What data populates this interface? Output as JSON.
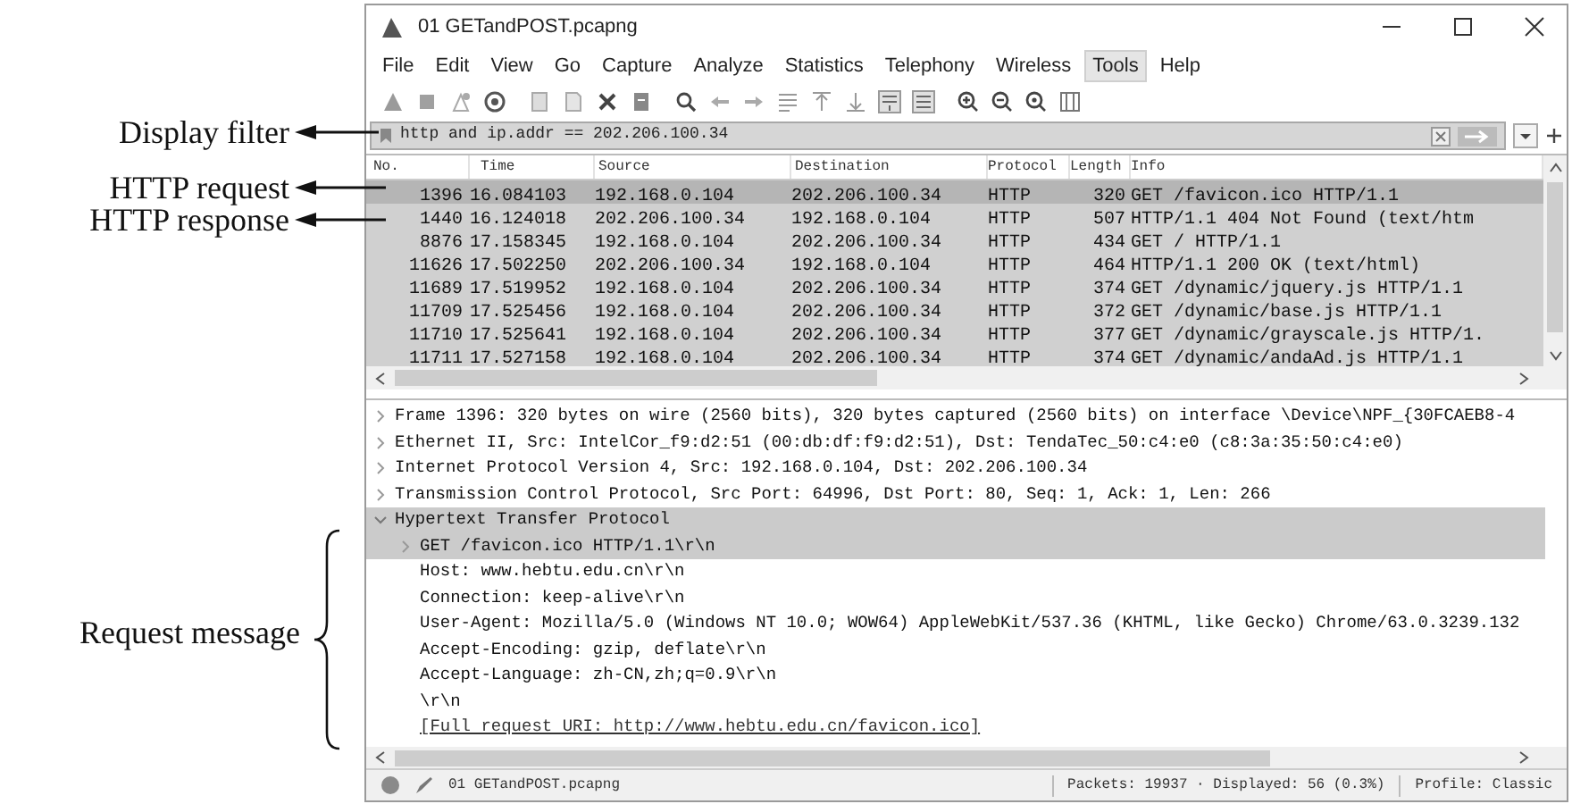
{
  "annotations": [
    {
      "kind": "arrow",
      "label": "Display filter"
    },
    {
      "kind": "arrow",
      "label": "HTTP request"
    },
    {
      "kind": "arrow",
      "label": "HTTP response"
    },
    {
      "kind": "brace",
      "label": "Request message"
    }
  ],
  "window": {
    "title": "01 GETandPOST.pcapng"
  },
  "menu": [
    {
      "label": "File",
      "selected": false
    },
    {
      "label": "Edit",
      "selected": false
    },
    {
      "label": "View",
      "selected": false
    },
    {
      "label": "Go",
      "selected": false
    },
    {
      "label": "Capture",
      "selected": false
    },
    {
      "label": "Analyze",
      "selected": false
    },
    {
      "label": "Statistics",
      "selected": false
    },
    {
      "label": "Telephony",
      "selected": false
    },
    {
      "label": "Wireless",
      "selected": false
    },
    {
      "label": "Tools",
      "selected": true
    },
    {
      "label": "Help",
      "selected": false
    }
  ],
  "filter": {
    "value": "http and ip.addr == 202.206.100.34"
  },
  "packet_list": {
    "columns": [
      "No.",
      "Time",
      "Source",
      "Destination",
      "Protocol",
      "Length",
      "Info"
    ],
    "rows": [
      {
        "selected": true,
        "cells": [
          "1396",
          "16.084103",
          "192.168.0.104",
          "202.206.100.34",
          "HTTP",
          "320",
          "GET /favicon.ico HTTP/1.1"
        ]
      },
      {
        "selected": false,
        "cells": [
          "1440",
          "16.124018",
          "202.206.100.34",
          "192.168.0.104",
          "HTTP",
          "507",
          "HTTP/1.1 404 Not Found  (text/htm"
        ]
      },
      {
        "selected": false,
        "cells": [
          "8876",
          "17.158345",
          "192.168.0.104",
          "202.206.100.34",
          "HTTP",
          "434",
          "GET / HTTP/1.1"
        ]
      },
      {
        "selected": false,
        "cells": [
          "11626",
          "17.502250",
          "202.206.100.34",
          "192.168.0.104",
          "HTTP",
          "464",
          "HTTP/1.1 200 OK  (text/html)"
        ]
      },
      {
        "selected": false,
        "cells": [
          "11689",
          "17.519952",
          "192.168.0.104",
          "202.206.100.34",
          "HTTP",
          "374",
          "GET /dynamic/jquery.js HTTP/1.1"
        ]
      },
      {
        "selected": false,
        "cells": [
          "11709",
          "17.525456",
          "192.168.0.104",
          "202.206.100.34",
          "HTTP",
          "372",
          "GET /dynamic/base.js HTTP/1.1"
        ]
      },
      {
        "selected": false,
        "cells": [
          "11710",
          "17.525641",
          "192.168.0.104",
          "202.206.100.34",
          "HTTP",
          "377",
          "GET /dynamic/grayscale.js HTTP/1."
        ]
      },
      {
        "selected": false,
        "cells": [
          "11711",
          "17.527158",
          "192.168.0.104",
          "202.206.100.34",
          "HTTP",
          "374",
          "GET /dynamic/andaAd.js HTTP/1.1"
        ]
      }
    ]
  },
  "details": [
    {
      "text": "Frame 1396: 320 bytes on wire (2560 bits), 320 bytes captured (2560 bits) on interface \\Device\\NPF_{30FCAEB8-4",
      "expanded": false,
      "selected": false
    },
    {
      "text": "Ethernet II, Src: IntelCor_f9:d2:51 (00:db:df:f9:d2:51), Dst: TendaTec_50:c4:e0 (c8:3a:35:50:c4:e0)",
      "expanded": false,
      "selected": false
    },
    {
      "text": "Internet Protocol Version 4, Src: 192.168.0.104, Dst: 202.206.100.34",
      "expanded": false,
      "selected": false
    },
    {
      "text": "Transmission Control Protocol, Src Port: 64996, Dst Port: 80, Seq: 1, Ack: 1, Len: 266",
      "expanded": false,
      "selected": false
    },
    {
      "text": "Hypertext Transfer Protocol",
      "expanded": true,
      "selected": true,
      "children": [
        {
          "text": "GET /favicon.ico HTTP/1.1\\r\\n",
          "expanded": false,
          "selected": true
        },
        {
          "text": "Host: www.hebtu.edu.cn\\r\\n",
          "selected": false
        },
        {
          "text": "Connection: keep-alive\\r\\n",
          "selected": false
        },
        {
          "text": "User-Agent: Mozilla/5.0 (Windows NT 10.0; WOW64) AppleWebKit/537.36 (KHTML, like Gecko) Chrome/63.0.3239.132",
          "selected": false
        },
        {
          "text": "Accept-Encoding: gzip, deflate\\r\\n",
          "selected": false
        },
        {
          "text": "Accept-Language: zh-CN,zh;q=0.9\\r\\n",
          "selected": false
        },
        {
          "text": "\\r\\n",
          "selected": false
        },
        {
          "text": "[Full request URI: http://www.hebtu.edu.cn/favicon.ico]",
          "selected": false,
          "kind": "generated"
        }
      ]
    }
  ],
  "status_bar": {
    "file": "01 GETandPOST.pcapng",
    "packets": "Packets: 19937 · Displayed: 56 (0.3%)",
    "profile": "Profile: Classic"
  }
}
